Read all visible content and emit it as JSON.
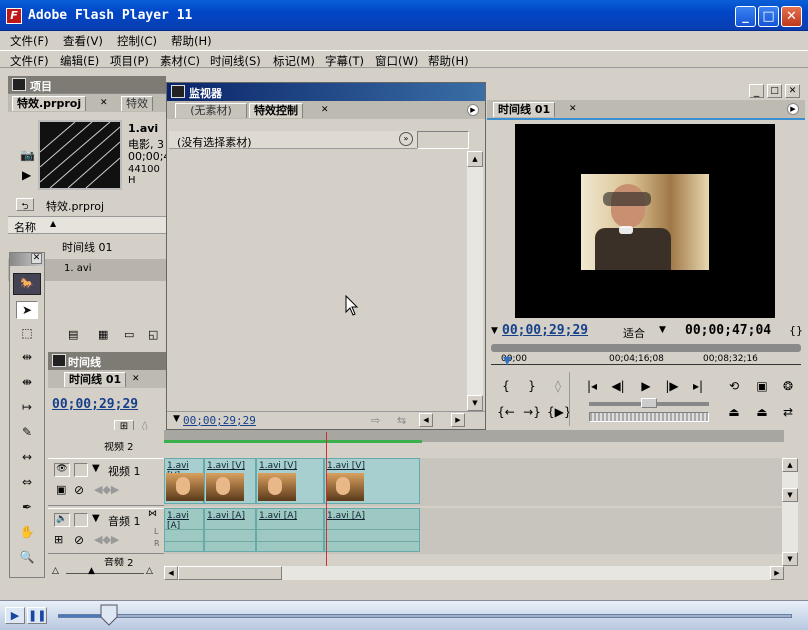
{
  "window": {
    "title": "Adobe Flash Player 11",
    "icon": "F"
  },
  "menu1": [
    "文件(F)",
    "查看(V)",
    "控制(C)",
    "帮助(H)"
  ],
  "menu2": [
    "文件(F)",
    "编辑(E)",
    "项目(P)",
    "素材(C)",
    "时间线(S)",
    "标记(M)",
    "字幕(T)",
    "窗口(W)",
    "帮助(H)"
  ],
  "project": {
    "title": "项目",
    "tab_active": "特效.prproj",
    "tab_inactive": "特效",
    "clip_name": "1.avi",
    "clip_line2": "电影, 3",
    "clip_line3": "00;00;4",
    "clip_line4": "44100 H",
    "project_label": "特效.prproj",
    "col_name": "名称",
    "items": [
      "时间线 01",
      "1. avi"
    ]
  },
  "monitor": {
    "title": "监视器",
    "tab_inactive": "(无素材)",
    "tab_active": "特效控制",
    "no_clip": "(没有选择素材)",
    "timecode": "00;00;29;29"
  },
  "program": {
    "tab": "时间线 01",
    "timecode_left": "00;00;29;29",
    "fit": "适合",
    "timecode_right": "00;00;47;04",
    "ruler": [
      "00;00",
      "00;04;16;08",
      "00;08;32;16"
    ]
  },
  "timeline": {
    "panel_title": "时间线",
    "tab": "时间线 01",
    "timecode": "00;00;29;29",
    "tracks": {
      "video_hidden": "视频 2",
      "video": "视频 1",
      "audio": "音频 1",
      "audio_hidden": "音频 2"
    },
    "video_clips": [
      "1.avi [V]",
      "1.avi [V]",
      "1.avi [V]",
      "1.avi [V]"
    ],
    "audio_clips": [
      "1.avi [A]",
      "1.avi [A]",
      "1.avi [A]",
      "1.avi [A]"
    ]
  },
  "player": {
    "progress": 0.07
  }
}
